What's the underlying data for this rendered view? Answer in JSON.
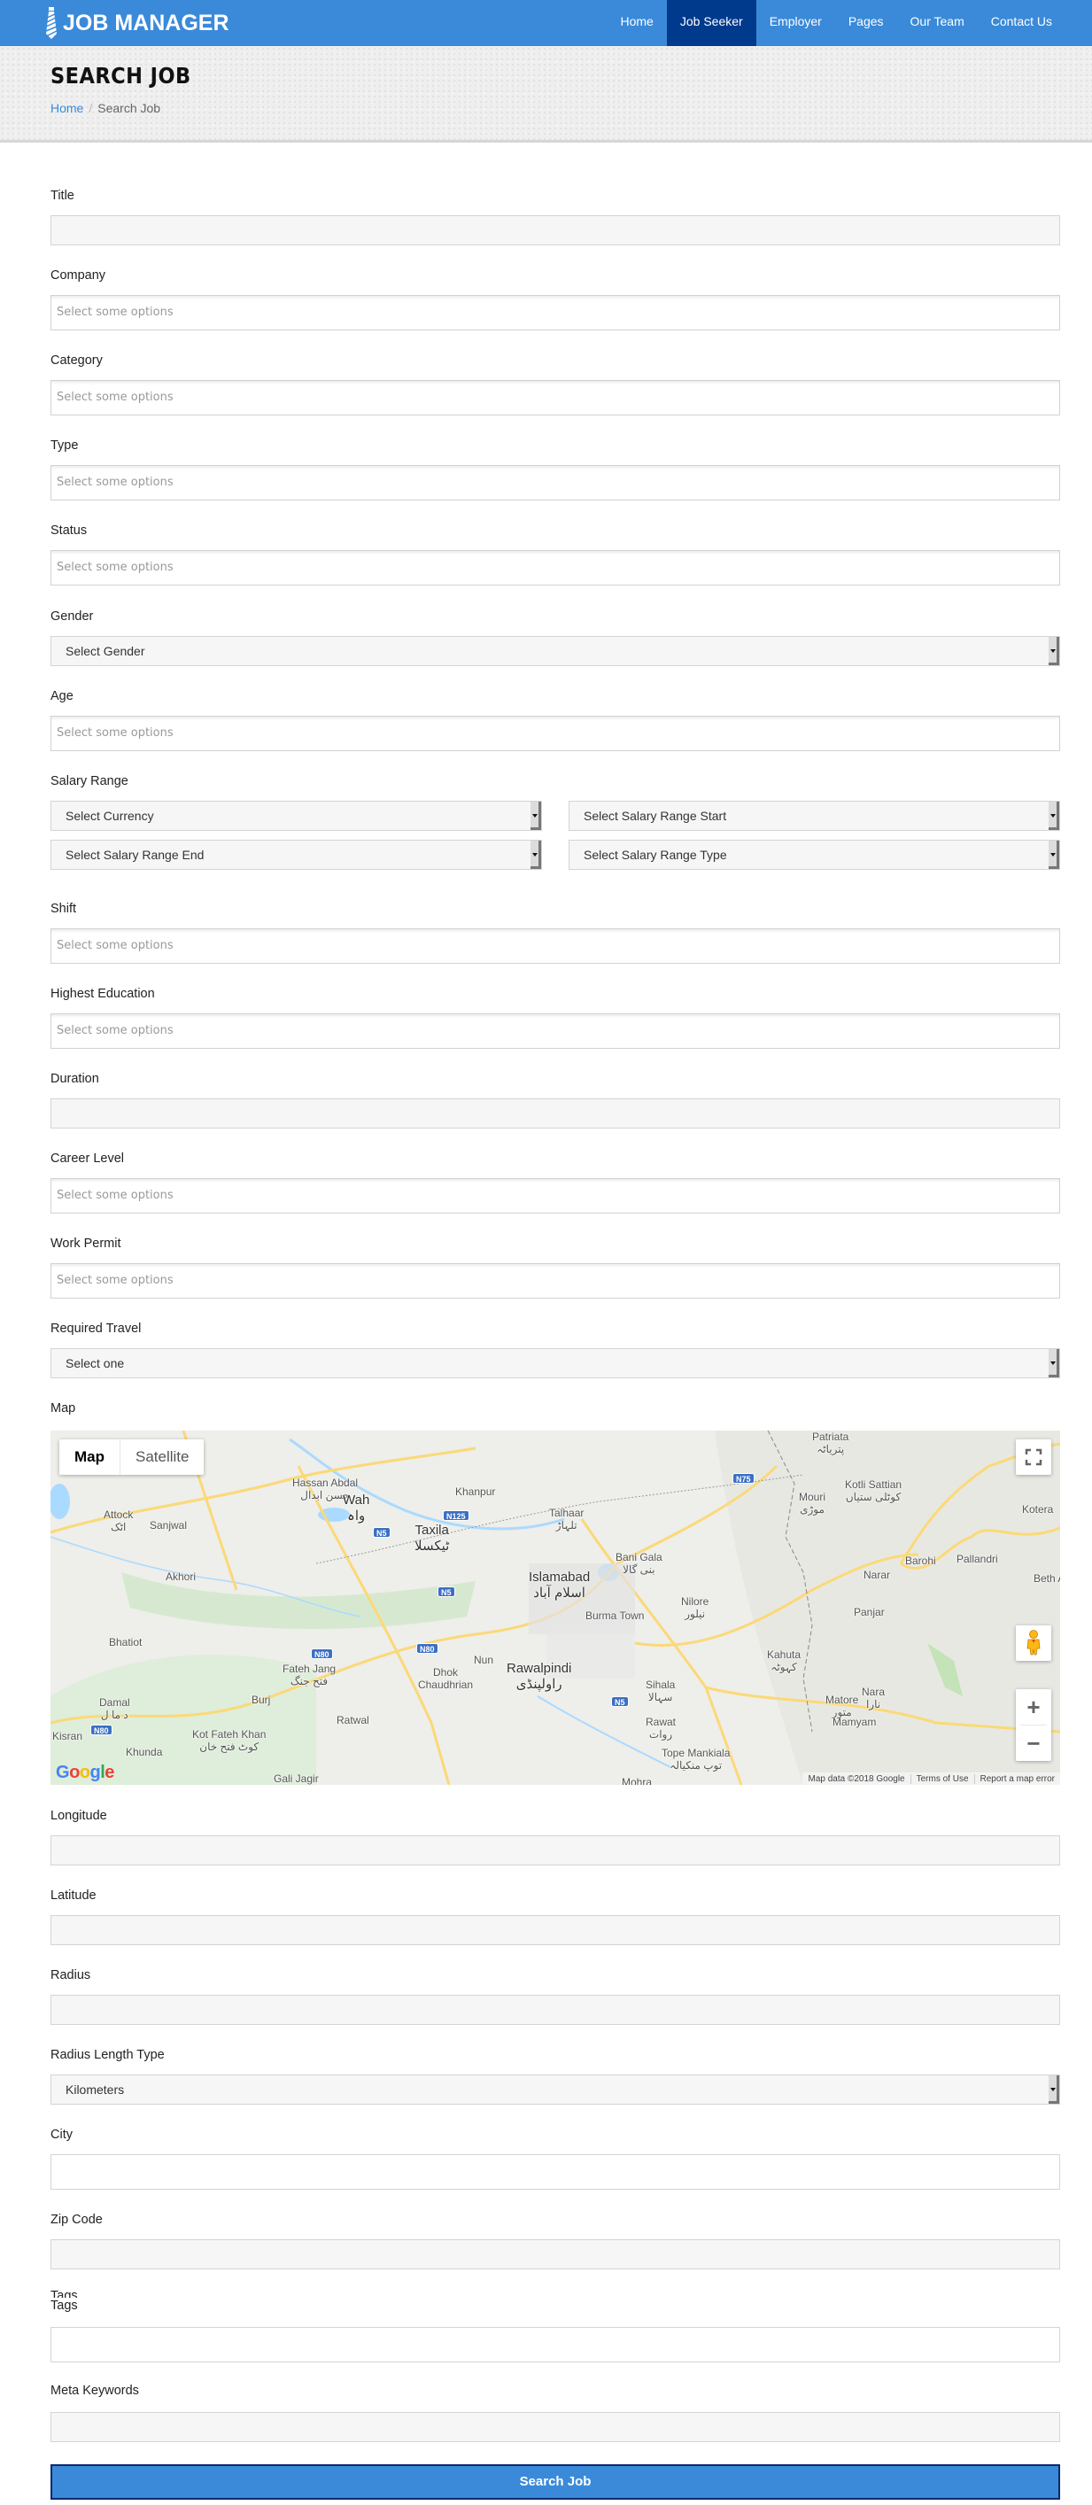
{
  "brand": {
    "name": "JOB MANAGER",
    "icon": "necktie-icon"
  },
  "nav": {
    "items": [
      {
        "label": "Home",
        "active": false
      },
      {
        "label": "Job Seeker",
        "active": true
      },
      {
        "label": "Employer",
        "active": false
      },
      {
        "label": "Pages",
        "active": false
      },
      {
        "label": "Our Team",
        "active": false
      },
      {
        "label": "Contact Us",
        "active": false
      }
    ]
  },
  "page_header": {
    "title": "SEARCH JOB",
    "breadcrumb": {
      "home": "Home",
      "separator": "/",
      "current": "Search Job"
    }
  },
  "form": {
    "title": {
      "label": "Title",
      "value": ""
    },
    "company": {
      "label": "Company",
      "placeholder": "Select some options"
    },
    "category": {
      "label": "Category",
      "placeholder": "Select some options"
    },
    "type": {
      "label": "Type",
      "placeholder": "Select some options"
    },
    "status": {
      "label": "Status",
      "placeholder": "Select some options"
    },
    "gender": {
      "label": "Gender",
      "selected": "Select Gender"
    },
    "age": {
      "label": "Age",
      "placeholder": "Select some options"
    },
    "salary_range": {
      "label": "Salary Range",
      "currency": "Select Currency",
      "start": "Select Salary Range Start",
      "end": "Select Salary Range End",
      "type": "Select Salary Range Type"
    },
    "shift": {
      "label": "Shift",
      "placeholder": "Select some options"
    },
    "highest_education": {
      "label": "Highest Education",
      "placeholder": "Select some options"
    },
    "duration": {
      "label": "Duration",
      "value": ""
    },
    "career_level": {
      "label": "Career Level",
      "placeholder": "Select some options"
    },
    "work_permit": {
      "label": "Work Permit",
      "placeholder": "Select some options"
    },
    "required_travel": {
      "label": "Required Travel",
      "selected": "Select one"
    },
    "map": {
      "label": "Map",
      "type_map": "Map",
      "type_satellite": "Satellite",
      "zoom_in": "+",
      "zoom_out": "−",
      "logo": "Google",
      "attribution": [
        "Map data ©2018 Google",
        "Terms of Use",
        "Report a map error"
      ],
      "places": [
        {
          "name": "Hassan Abdal",
          "urdu": "حسن ابدال"
        },
        {
          "name": "Wah",
          "urdu": "واہ"
        },
        {
          "name": "Attock",
          "urdu": "اٹک"
        },
        {
          "name": "Sanjwal",
          "urdu": ""
        },
        {
          "name": "Akhori",
          "urdu": ""
        },
        {
          "name": "Khanpur",
          "urdu": ""
        },
        {
          "name": "Taxila",
          "urdu": "ٹیکسلا"
        },
        {
          "name": "Talhaar",
          "urdu": "تلہاڑ"
        },
        {
          "name": "Islamabad",
          "urdu": "اسلام آباد"
        },
        {
          "name": "Bani Gala",
          "urdu": "بنی گالا"
        },
        {
          "name": "Nilore",
          "urdu": "نیلور"
        },
        {
          "name": "Burma Town",
          "urdu": ""
        },
        {
          "name": "Patriata",
          "urdu": "پتریاٹہ"
        },
        {
          "name": "Mouri",
          "urdu": "موڑی"
        },
        {
          "name": "Kotli Sattian",
          "urdu": "کوٹلی ستیاں"
        },
        {
          "name": "Kotera",
          "urdu": ""
        },
        {
          "name": "Barohi",
          "urdu": ""
        },
        {
          "name": "Pallandri",
          "urdu": ""
        },
        {
          "name": "Narar",
          "urdu": ""
        },
        {
          "name": "Panjar",
          "urdu": ""
        },
        {
          "name": "Beth Awan",
          "urdu": ""
        },
        {
          "name": "Bhatiot",
          "urdu": ""
        },
        {
          "name": "Fateh Jang",
          "urdu": "فتح جنگ"
        },
        {
          "name": "Burj",
          "urdu": ""
        },
        {
          "name": "Damal",
          "urdu": "د ما ل"
        },
        {
          "name": "Kisran",
          "urdu": ""
        },
        {
          "name": "Khunda",
          "urdu": ""
        },
        {
          "name": "Kot Fateh Khan",
          "urdu": "کوٹ فتح خان"
        },
        {
          "name": "Ratwal",
          "urdu": ""
        },
        {
          "name": "Gali Jagir",
          "urdu": ""
        },
        {
          "name": "Nun",
          "urdu": ""
        },
        {
          "name": "Dhok Chaudhrian",
          "urdu": ""
        },
        {
          "name": "Rawalpindi",
          "urdu": "راولپنڈی"
        },
        {
          "name": "Sihala",
          "urdu": "سہالا"
        },
        {
          "name": "Rawat",
          "urdu": "روات"
        },
        {
          "name": "Tope Mankiala",
          "urdu": "توپ منکیالہ"
        },
        {
          "name": "Mohra",
          "urdu": ""
        },
        {
          "name": "Kahuta",
          "urdu": "کہوٹہ"
        },
        {
          "name": "Matore",
          "urdu": "متور"
        },
        {
          "name": "Nara",
          "urdu": "نارا"
        },
        {
          "name": "Mamyam",
          "urdu": ""
        }
      ],
      "road_shields": [
        "N5",
        "N125",
        "N75",
        "N80"
      ]
    },
    "longitude": {
      "label": "Longitude",
      "value": ""
    },
    "latitude": {
      "label": "Latitude",
      "value": ""
    },
    "radius": {
      "label": "Radius",
      "value": ""
    },
    "radius_length_type": {
      "label": "Radius Length Type",
      "selected": "Kilometers"
    },
    "city": {
      "label": "City",
      "value": ""
    },
    "zip_code": {
      "label": "Zip Code",
      "value": ""
    },
    "tags": {
      "label": "Tags",
      "value": ""
    },
    "meta_keywords": {
      "label": "Meta Keywords",
      "value": ""
    },
    "submit_label": "Search Job"
  },
  "colors": {
    "primary": "#3a8ad9",
    "nav_active": "#003a8c",
    "button_border": "#0b2a6e"
  }
}
